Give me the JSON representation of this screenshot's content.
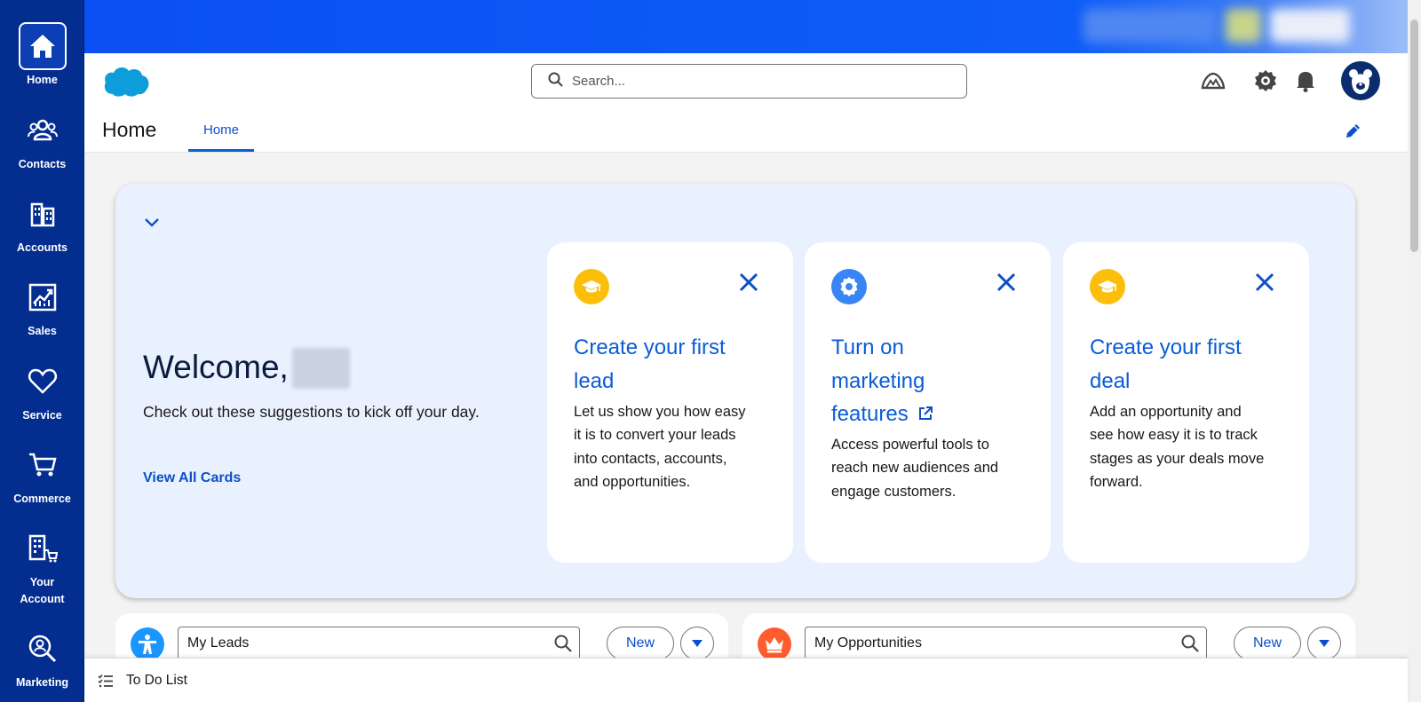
{
  "nav": {
    "items": [
      {
        "label": "Home",
        "icon": "home-icon",
        "active": true
      },
      {
        "label": "Contacts",
        "icon": "contacts-icon"
      },
      {
        "label": "Accounts",
        "icon": "accounts-icon"
      },
      {
        "label": "Sales",
        "icon": "sales-icon"
      },
      {
        "label": "Service",
        "icon": "service-icon"
      },
      {
        "label": "Commerce",
        "icon": "commerce-icon"
      },
      {
        "label": "Your Account",
        "icon": "your-account-icon"
      },
      {
        "label": "Marketing",
        "icon": "marketing-icon"
      }
    ]
  },
  "header": {
    "search_placeholder": "Search...",
    "page_title": "Home",
    "tab_label": "Home"
  },
  "welcome": {
    "title": "Welcome,",
    "subtitle": "Check out these suggestions to kick off your day.",
    "view_all": "View All Cards",
    "cards": [
      {
        "title": "Create your first lead",
        "body": "Let us show you how easy it is to convert your leads into contacts, accounts, and opportunities.",
        "icon": "graduation-cap-icon",
        "color": "#fbbf0b"
      },
      {
        "title": "Turn on marketing features",
        "body": "Access powerful tools to reach new audiences and engage customers.",
        "icon": "gear-icon",
        "color": "#3a85f5"
      },
      {
        "title": "Create your first deal",
        "body": "Add an opportunity and see how easy it is to track stages as your deals move forward.",
        "icon": "graduation-cap-icon",
        "color": "#fbbf0b"
      }
    ]
  },
  "lists": [
    {
      "label": "My Leads",
      "new_label": "New",
      "icon": "lead-icon",
      "color": "#1b96ff"
    },
    {
      "label": "My Opportunities",
      "new_label": "New",
      "icon": "crown-icon",
      "color": "#ff5d2d"
    }
  ],
  "todo": {
    "label": "To Do List"
  },
  "colors": {
    "rail": "#032d8f",
    "topbar": "#0e5cf7",
    "accent": "#0b5cd8",
    "panel": "#eaf1fe"
  }
}
